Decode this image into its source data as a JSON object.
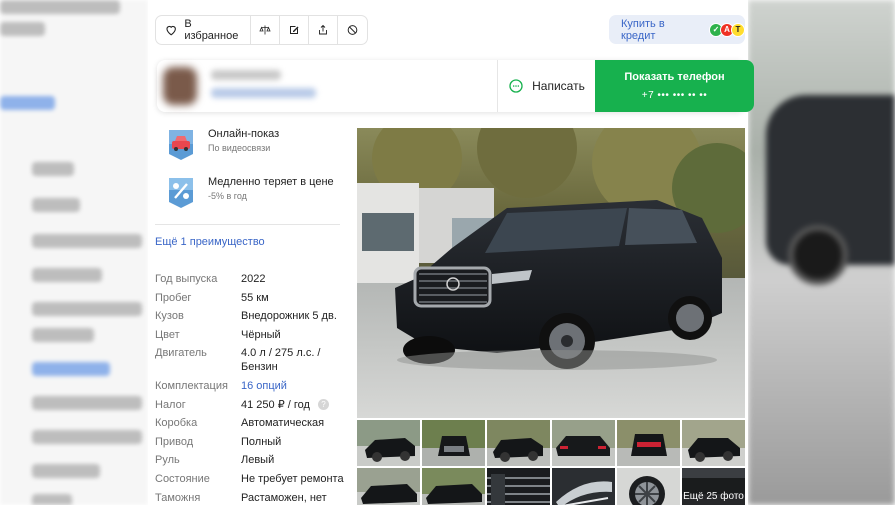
{
  "toolbar": {
    "favorite_label": "В избранное",
    "credit_label": "Купить в кредит",
    "banks": [
      {
        "letter": "✓",
        "color": "#ffffff",
        "bg": "#2fb24c"
      },
      {
        "letter": "А",
        "color": "#ffffff",
        "bg": "#ef3124"
      },
      {
        "letter": "Т",
        "color": "#222222",
        "bg": "#ffdd2d"
      }
    ]
  },
  "seller": {
    "write_label": "Написать",
    "show_phone_label": "Показать телефон",
    "phone_masked": "+7 ••• ••• •• ••"
  },
  "features": [
    {
      "title": "Онлайн-показ",
      "subtitle": "По видеосвязи",
      "icon": "car-video-icon"
    },
    {
      "title": "Медленно теряет в цене",
      "subtitle": "-5% в год",
      "icon": "percent-badge-icon"
    }
  ],
  "more_advantages": "Ещё 1 преимущество",
  "specs": [
    {
      "key": "Год выпуска",
      "value": "2022"
    },
    {
      "key": "Пробег",
      "value": "55 км"
    },
    {
      "key": "Кузов",
      "value": "Внедорожник 5 дв."
    },
    {
      "key": "Цвет",
      "value": "Чёрный"
    },
    {
      "key": "Двигатель",
      "value": "4.0 л / 275 л.с. / Бензин"
    },
    {
      "key": "Комплектация",
      "value": "16 опций",
      "link": true
    },
    {
      "key": "Налог",
      "value": "41 250 ₽ / год",
      "info": true
    },
    {
      "key": "Коробка",
      "value": "Автоматическая"
    },
    {
      "key": "Привод",
      "value": "Полный"
    },
    {
      "key": "Руль",
      "value": "Левый"
    },
    {
      "key": "Состояние",
      "value": "Не требует ремонта"
    },
    {
      "key": "Таможня",
      "value": "Растаможен, нет ПТС"
    }
  ],
  "gallery": {
    "more_photos_label": "Ещё 25 фото"
  },
  "colors": {
    "accent": "#3a66c7",
    "phone_button": "#17b14e"
  }
}
